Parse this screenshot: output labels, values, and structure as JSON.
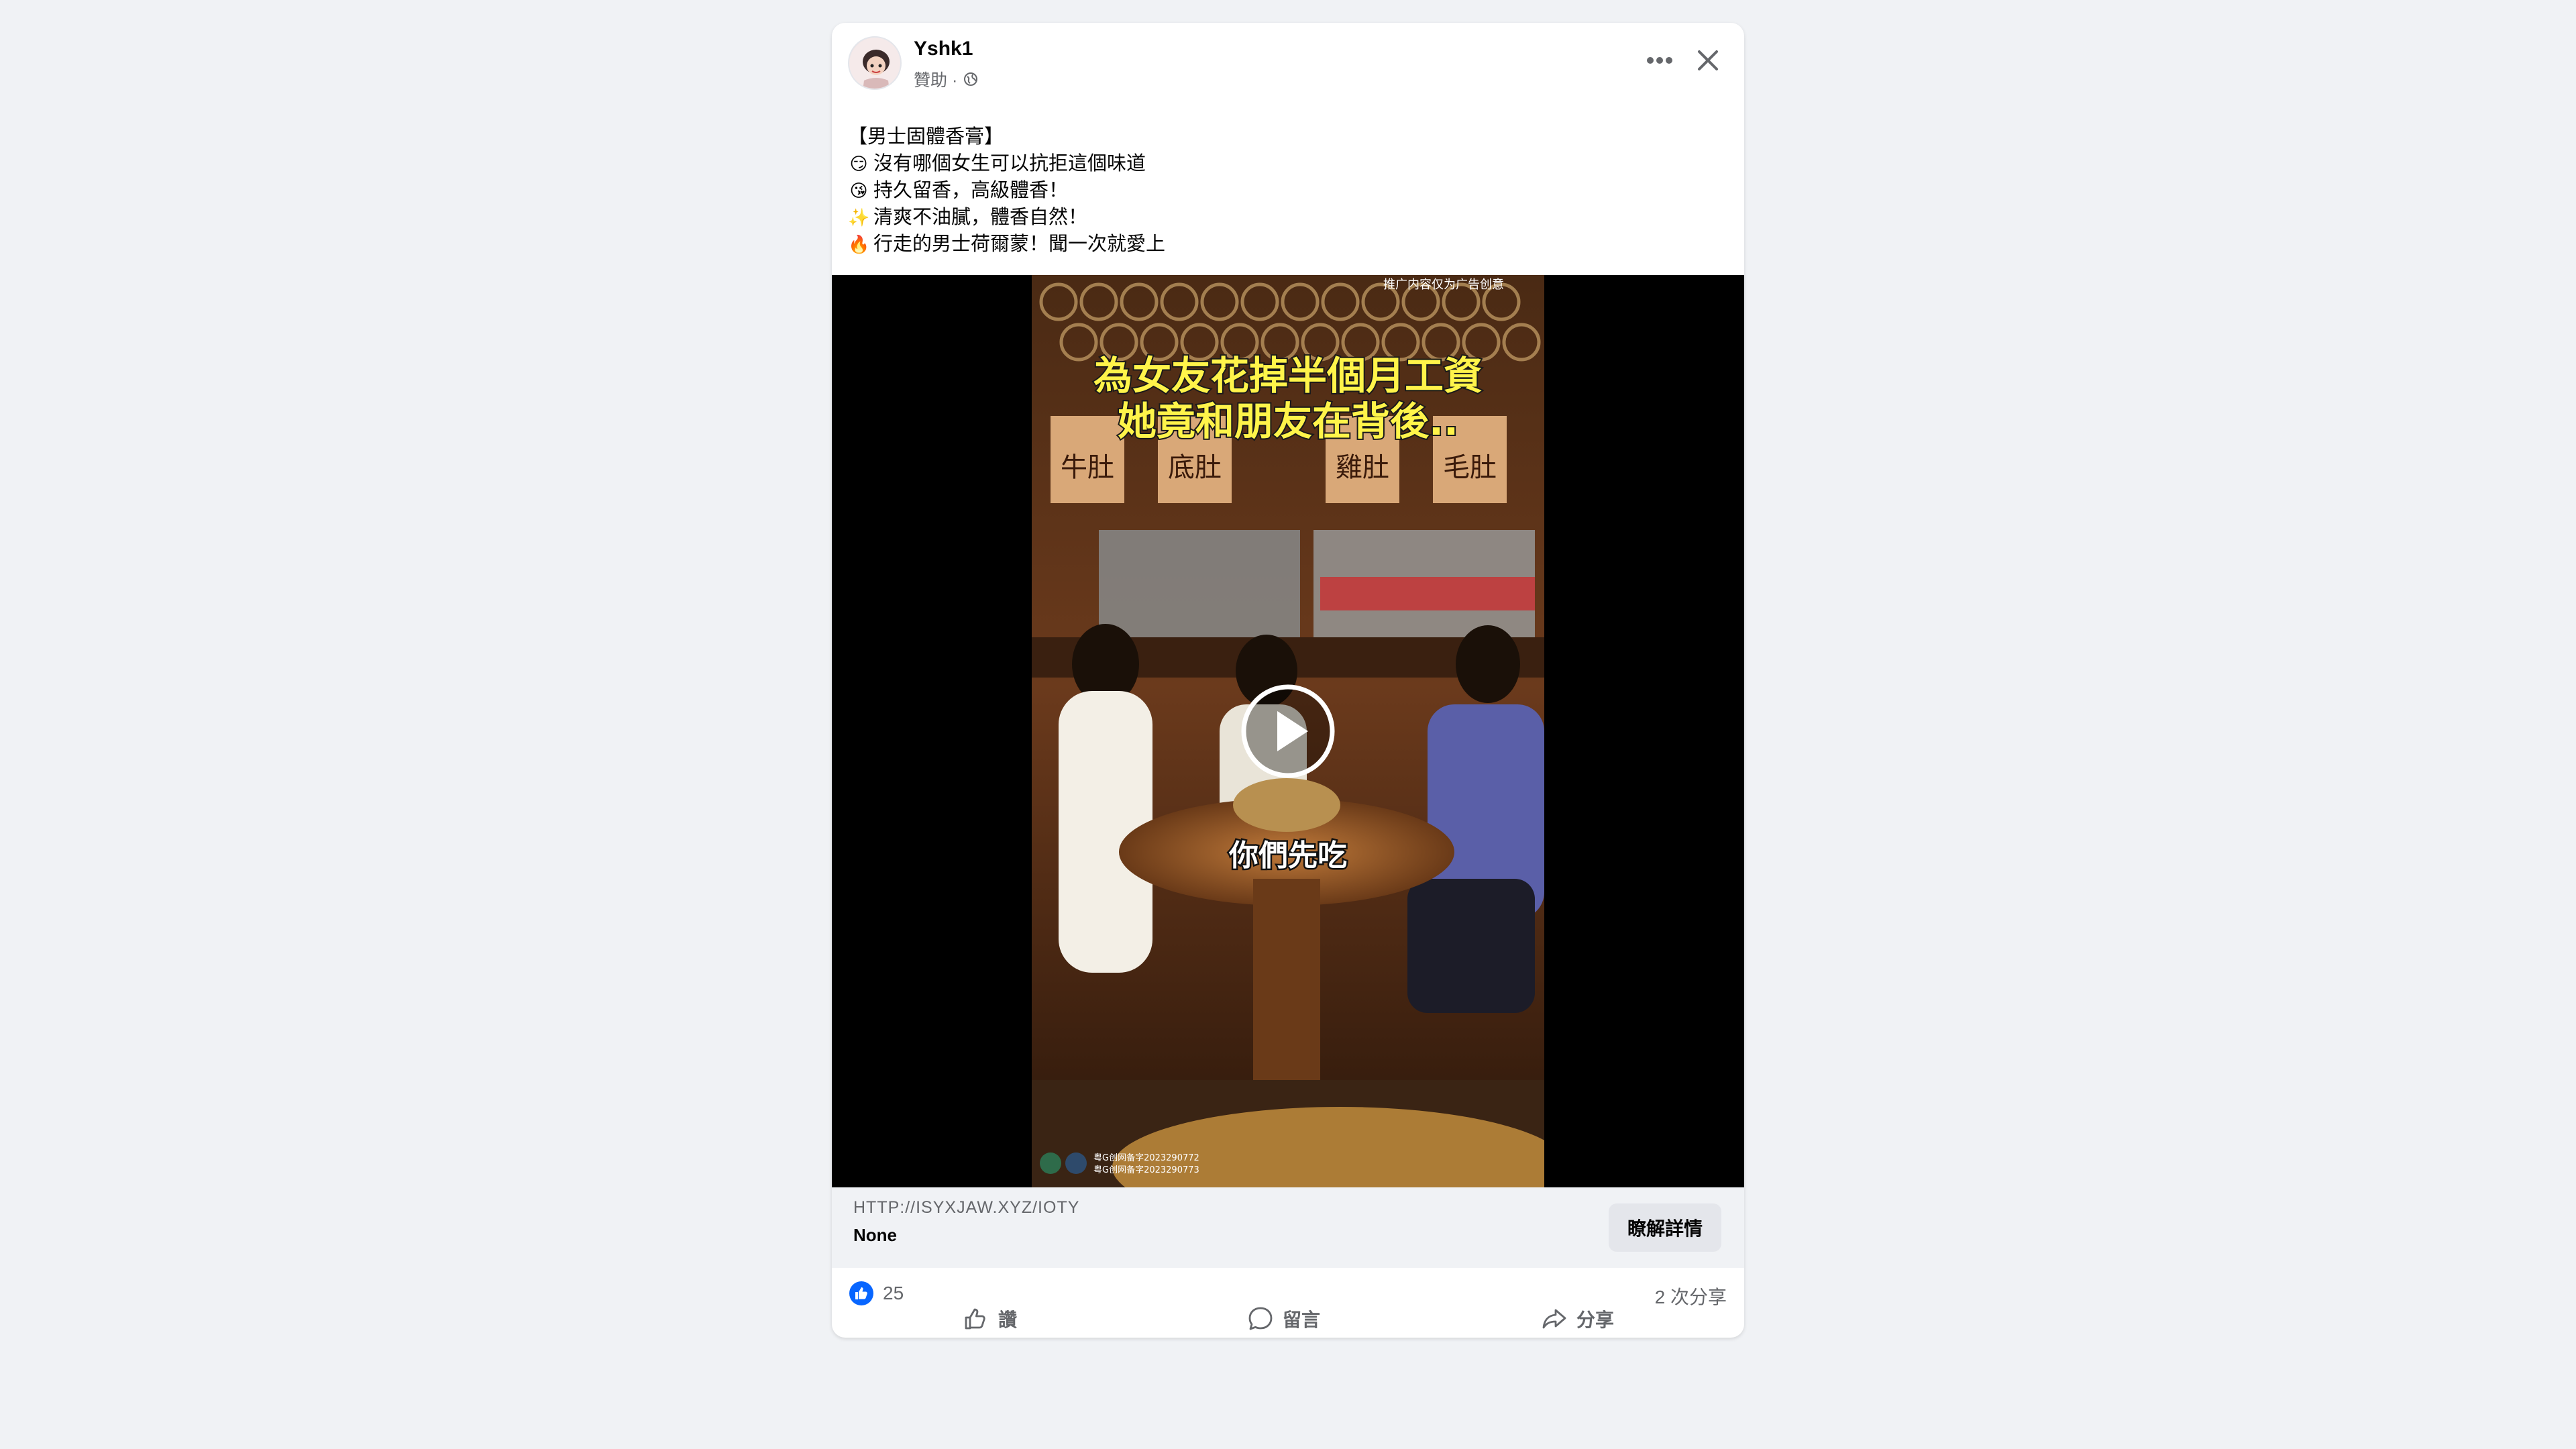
{
  "post": {
    "author": "Yshk1",
    "sponsored_label": "贊助 ·",
    "lines": [
      {
        "emoji": "",
        "text": "【男士固體香膏】"
      },
      {
        "emoji": "😏",
        "text": "沒有哪個女生可以抗拒這個味道"
      },
      {
        "emoji": "😘",
        "text": "持久留香，高級體香！"
      },
      {
        "emoji": "✨",
        "text": "清爽不油膩，體香自然！"
      },
      {
        "emoji": "🔥",
        "text": "行走的男士荷爾蒙！聞一次就愛上"
      }
    ]
  },
  "video": {
    "headline_line1": "為女友花掉半個月工資",
    "headline_line2": "她竟和朋友在背後..",
    "subtitle": "你們先吃",
    "corner_note": "推广内容仅为广告创意",
    "hanging_signs": [
      "牛肚",
      "底肚",
      "雞肚",
      "毛肚"
    ],
    "credit_line1": "粤G创网备字2023290772",
    "credit_line2": "粤G创网备字2023290773"
  },
  "link": {
    "url": "HTTP://ISYXJAW.XYZ/IOTY",
    "title": "None",
    "cta_label": "瞭解詳情"
  },
  "reactions": {
    "like_count": "25",
    "share_count": "2 次分享"
  },
  "actions": {
    "like_label": "讚",
    "comment_label": "留言",
    "share_label": "分享"
  },
  "colors": {
    "accent": "#0866ff",
    "secondary_text": "#65676b",
    "background": "#f0f2f5"
  }
}
